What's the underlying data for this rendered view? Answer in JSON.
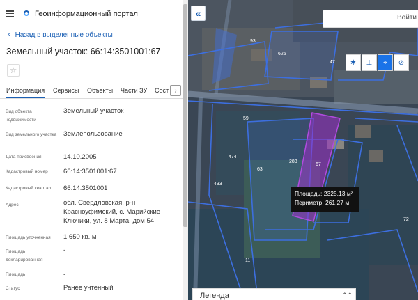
{
  "header": {
    "title": "Геоинформационный портал"
  },
  "nav": {
    "back_label": "Назад в выделенные объекты"
  },
  "object": {
    "title": "Земельный участок: 66:14:3501001:67"
  },
  "tabs": [
    "Информация",
    "Сервисы",
    "Объекты",
    "Части ЗУ",
    "Сост"
  ],
  "attributes": [
    {
      "label": "Вид объекта недвижимости",
      "value": "Земельный участок"
    },
    {
      "label": "Вид земельного участка",
      "value": "Землепользование"
    },
    {
      "label": "Дата присвоения",
      "value": "14.10.2005"
    },
    {
      "label": "Кадастровый номер",
      "value": "66:14:3501001:67"
    },
    {
      "label": "Кадастровый квартал",
      "value": "66:14:3501001"
    },
    {
      "label": "Адрес",
      "value": "обл. Свердловская, р-н Красноуфимский, с. Марийские Ключики, ул. 8 Марта, дом 54"
    },
    {
      "label": "Площадь уточненная",
      "value": "1 650 кв. м"
    },
    {
      "label": "Площадь декларированная",
      "value": "-"
    },
    {
      "label": "Площадь",
      "value": "-"
    },
    {
      "label": "Статус",
      "value": "Ранее учтенный"
    }
  ],
  "map": {
    "login_label": "Войти",
    "measurement": {
      "area_label": "Площадь:",
      "area_value": "2325.13 м²",
      "perimeter_label": "Периметр:",
      "perimeter_value": "261.27 м"
    },
    "parcel_labels": [
      "93",
      "625",
      "47",
      "59",
      "474",
      "63",
      "283",
      "67",
      "433",
      "72",
      "11"
    ],
    "legend_label": "Легенда",
    "colors": {
      "accent": "#1a5fb4",
      "parcel_outline": "#3d6fe0",
      "selected_parcel": "#9b30c8"
    }
  }
}
